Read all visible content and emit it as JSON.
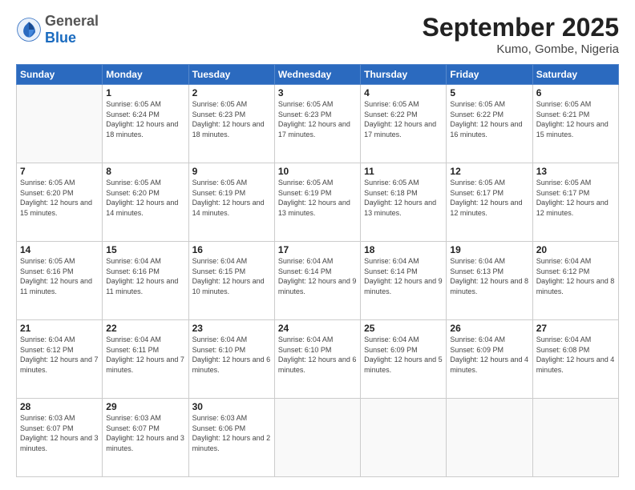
{
  "header": {
    "logo_general": "General",
    "logo_blue": "Blue",
    "month": "September 2025",
    "location": "Kumo, Gombe, Nigeria"
  },
  "weekdays": [
    "Sunday",
    "Monday",
    "Tuesday",
    "Wednesday",
    "Thursday",
    "Friday",
    "Saturday"
  ],
  "weeks": [
    [
      {
        "day": "",
        "sunrise": "",
        "sunset": "",
        "daylight": ""
      },
      {
        "day": "1",
        "sunrise": "6:05 AM",
        "sunset": "6:24 PM",
        "daylight": "12 hours and 18 minutes."
      },
      {
        "day": "2",
        "sunrise": "6:05 AM",
        "sunset": "6:23 PM",
        "daylight": "12 hours and 18 minutes."
      },
      {
        "day": "3",
        "sunrise": "6:05 AM",
        "sunset": "6:23 PM",
        "daylight": "12 hours and 17 minutes."
      },
      {
        "day": "4",
        "sunrise": "6:05 AM",
        "sunset": "6:22 PM",
        "daylight": "12 hours and 17 minutes."
      },
      {
        "day": "5",
        "sunrise": "6:05 AM",
        "sunset": "6:22 PM",
        "daylight": "12 hours and 16 minutes."
      },
      {
        "day": "6",
        "sunrise": "6:05 AM",
        "sunset": "6:21 PM",
        "daylight": "12 hours and 15 minutes."
      }
    ],
    [
      {
        "day": "7",
        "sunrise": "6:05 AM",
        "sunset": "6:20 PM",
        "daylight": "12 hours and 15 minutes."
      },
      {
        "day": "8",
        "sunrise": "6:05 AM",
        "sunset": "6:20 PM",
        "daylight": "12 hours and 14 minutes."
      },
      {
        "day": "9",
        "sunrise": "6:05 AM",
        "sunset": "6:19 PM",
        "daylight": "12 hours and 14 minutes."
      },
      {
        "day": "10",
        "sunrise": "6:05 AM",
        "sunset": "6:19 PM",
        "daylight": "12 hours and 13 minutes."
      },
      {
        "day": "11",
        "sunrise": "6:05 AM",
        "sunset": "6:18 PM",
        "daylight": "12 hours and 13 minutes."
      },
      {
        "day": "12",
        "sunrise": "6:05 AM",
        "sunset": "6:17 PM",
        "daylight": "12 hours and 12 minutes."
      },
      {
        "day": "13",
        "sunrise": "6:05 AM",
        "sunset": "6:17 PM",
        "daylight": "12 hours and 12 minutes."
      }
    ],
    [
      {
        "day": "14",
        "sunrise": "6:05 AM",
        "sunset": "6:16 PM",
        "daylight": "12 hours and 11 minutes."
      },
      {
        "day": "15",
        "sunrise": "6:04 AM",
        "sunset": "6:16 PM",
        "daylight": "12 hours and 11 minutes."
      },
      {
        "day": "16",
        "sunrise": "6:04 AM",
        "sunset": "6:15 PM",
        "daylight": "12 hours and 10 minutes."
      },
      {
        "day": "17",
        "sunrise": "6:04 AM",
        "sunset": "6:14 PM",
        "daylight": "12 hours and 9 minutes."
      },
      {
        "day": "18",
        "sunrise": "6:04 AM",
        "sunset": "6:14 PM",
        "daylight": "12 hours and 9 minutes."
      },
      {
        "day": "19",
        "sunrise": "6:04 AM",
        "sunset": "6:13 PM",
        "daylight": "12 hours and 8 minutes."
      },
      {
        "day": "20",
        "sunrise": "6:04 AM",
        "sunset": "6:12 PM",
        "daylight": "12 hours and 8 minutes."
      }
    ],
    [
      {
        "day": "21",
        "sunrise": "6:04 AM",
        "sunset": "6:12 PM",
        "daylight": "12 hours and 7 minutes."
      },
      {
        "day": "22",
        "sunrise": "6:04 AM",
        "sunset": "6:11 PM",
        "daylight": "12 hours and 7 minutes."
      },
      {
        "day": "23",
        "sunrise": "6:04 AM",
        "sunset": "6:10 PM",
        "daylight": "12 hours and 6 minutes."
      },
      {
        "day": "24",
        "sunrise": "6:04 AM",
        "sunset": "6:10 PM",
        "daylight": "12 hours and 6 minutes."
      },
      {
        "day": "25",
        "sunrise": "6:04 AM",
        "sunset": "6:09 PM",
        "daylight": "12 hours and 5 minutes."
      },
      {
        "day": "26",
        "sunrise": "6:04 AM",
        "sunset": "6:09 PM",
        "daylight": "12 hours and 4 minutes."
      },
      {
        "day": "27",
        "sunrise": "6:04 AM",
        "sunset": "6:08 PM",
        "daylight": "12 hours and 4 minutes."
      }
    ],
    [
      {
        "day": "28",
        "sunrise": "6:03 AM",
        "sunset": "6:07 PM",
        "daylight": "12 hours and 3 minutes."
      },
      {
        "day": "29",
        "sunrise": "6:03 AM",
        "sunset": "6:07 PM",
        "daylight": "12 hours and 3 minutes."
      },
      {
        "day": "30",
        "sunrise": "6:03 AM",
        "sunset": "6:06 PM",
        "daylight": "12 hours and 2 minutes."
      },
      {
        "day": "",
        "sunrise": "",
        "sunset": "",
        "daylight": ""
      },
      {
        "day": "",
        "sunrise": "",
        "sunset": "",
        "daylight": ""
      },
      {
        "day": "",
        "sunrise": "",
        "sunset": "",
        "daylight": ""
      },
      {
        "day": "",
        "sunrise": "",
        "sunset": "",
        "daylight": ""
      }
    ]
  ]
}
